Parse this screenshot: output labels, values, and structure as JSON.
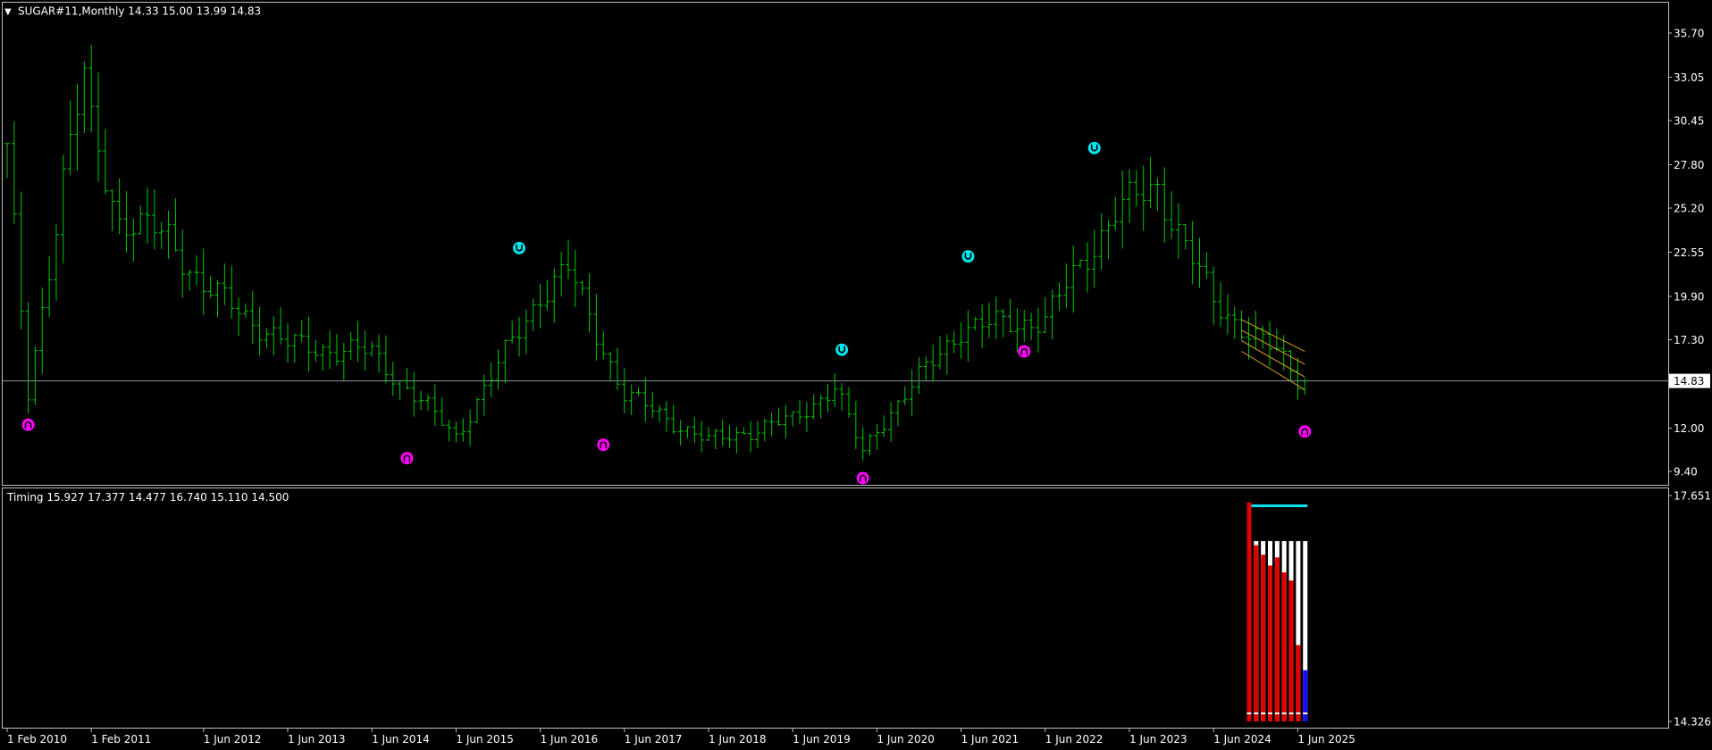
{
  "main_header": {
    "toggle_glyph": "▼",
    "text": "SUGAR#11,Monthly  14.33 15.00 13.99 14.83"
  },
  "indicator_header": {
    "text": "Timing 15.927 17.377 14.477 16.740 15.110 14.500"
  },
  "price_axis": {
    "ticks": [
      "35.70",
      "33.05",
      "30.45",
      "27.80",
      "25.20",
      "22.55",
      "19.90",
      "17.30",
      "14.83",
      "12.00",
      "9.40"
    ],
    "current_label": "14.83"
  },
  "indicator_axis": {
    "ticks": [
      "17.651",
      "14.326"
    ]
  },
  "time_axis": {
    "ticks": [
      "1 Feb 2010",
      "1 Feb 2011",
      "1 Jun 2012",
      "1 Jun 2013",
      "1 Jun 2014",
      "1 Jun 2015",
      "1 Jun 2016",
      "1 Jun 2017",
      "1 Jun 2018",
      "1 Jun 2019",
      "1 Jun 2020",
      "1 Jun 2021",
      "1 Jun 2022",
      "1 Jun 2023",
      "1 Jun 2024",
      "1 Jun 2025"
    ]
  },
  "colors": {
    "background": "#000000",
    "bars": "#00c800",
    "grid_frame": "#c0c0c0",
    "price_line": "#8a9aa6",
    "channel": "#d4a020",
    "arrow_up": "#ff00ff",
    "arrow_down": "#00e5ee",
    "hist_red": "#e00000",
    "hist_white": "#ffffff",
    "hist_blue": "#1010ff",
    "signal_line": "#00e5ee"
  },
  "chart_data": {
    "type": "ohlc",
    "symbol": "SUGAR#11",
    "timeframe": "Monthly",
    "last_bar": {
      "open": 14.33,
      "high": 15.0,
      "low": 13.99,
      "close": 14.83
    },
    "price_range": [
      8.8,
      37.0
    ],
    "keypoints": [
      {
        "date": "2010-02",
        "price": 28.5
      },
      {
        "date": "2010-05",
        "price": 14.0
      },
      {
        "date": "2010-10",
        "price": 27.0
      },
      {
        "date": "2011-01",
        "price": 33.0
      },
      {
        "date": "2011-02",
        "price": 30.0
      },
      {
        "date": "2011-06",
        "price": 24.5
      },
      {
        "date": "2012-01",
        "price": 23.5
      },
      {
        "date": "2012-06",
        "price": 20.5
      },
      {
        "date": "2013-06",
        "price": 17.0
      },
      {
        "date": "2014-06",
        "price": 16.5
      },
      {
        "date": "2015-06",
        "price": 11.5
      },
      {
        "date": "2016-06",
        "price": 20.0
      },
      {
        "date": "2016-10",
        "price": 21.5
      },
      {
        "date": "2017-06",
        "price": 14.0
      },
      {
        "date": "2018-06",
        "price": 11.2
      },
      {
        "date": "2019-06",
        "price": 12.5
      },
      {
        "date": "2019-12",
        "price": 14.5
      },
      {
        "date": "2020-04",
        "price": 10.5
      },
      {
        "date": "2020-06",
        "price": 12.0
      },
      {
        "date": "2021-06",
        "price": 18.0
      },
      {
        "date": "2022-06",
        "price": 18.5
      },
      {
        "date": "2023-04",
        "price": 25.0
      },
      {
        "date": "2023-10",
        "price": 26.5
      },
      {
        "date": "2024-06",
        "price": 19.5
      },
      {
        "date": "2025-03",
        "price": 16.5
      },
      {
        "date": "2025-07",
        "price": 14.5
      }
    ],
    "signals": {
      "up": [
        "2010-05",
        "2014-11",
        "2017-03",
        "2020-04",
        "2022-03",
        "2025-07"
      ],
      "down": [
        "2016-03",
        "2020-01",
        "2021-07",
        "2023-01"
      ]
    },
    "signal_prices": {
      "up": [
        12.2,
        10.2,
        11.0,
        9.0,
        16.6,
        11.8
      ],
      "down": [
        22.8,
        16.7,
        22.3,
        28.8
      ]
    },
    "channel": {
      "start": "2024-10",
      "end": "2025-07",
      "start_prices": [
        18.5,
        16.6
      ],
      "end_prices": [
        16.6,
        14.3
      ]
    },
    "timing_indicator": {
      "range": [
        14.326,
        17.651
      ],
      "months": [
        "2024-11",
        "2024-12",
        "2025-01",
        "2025-02",
        "2025-03",
        "2025-04",
        "2025-05",
        "2025-06",
        "2025-07"
      ],
      "red_top": [
        17.55,
        16.92,
        16.78,
        16.62,
        16.74,
        16.52,
        16.4,
        15.45,
        14.95
      ],
      "white_top": [
        null,
        16.98,
        16.98,
        16.98,
        16.98,
        16.98,
        16.98,
        16.98,
        16.98
      ],
      "blue_top": [
        null,
        null,
        null,
        null,
        null,
        null,
        null,
        null,
        15.08
      ],
      "signal_level": 17.5
    }
  }
}
